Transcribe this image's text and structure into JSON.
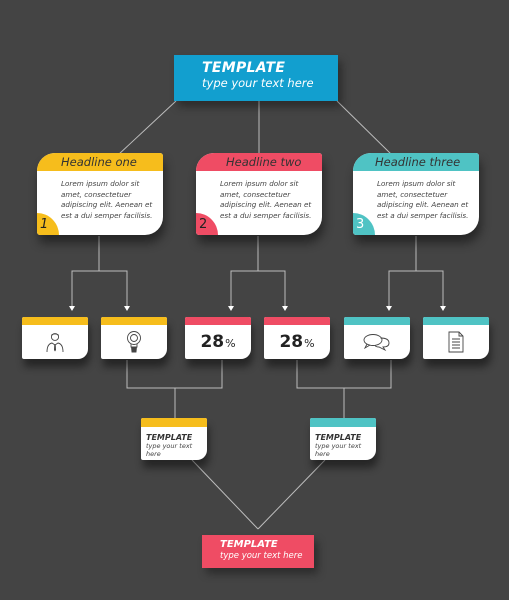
{
  "colors": {
    "background": "#444444",
    "connector": "#bdbdbd",
    "blue": "#129fcf",
    "yellow": "#f6bd1c",
    "red": "#ef4c64",
    "teal": "#4fc3c4"
  },
  "top": {
    "title": "TEMPLATE",
    "subtitle": "type your text here"
  },
  "cards": [
    {
      "headline": "Headline one",
      "number": "1",
      "body": "Lorem ipsum dolor sit amet, consectetuer adipiscing elit. Aenean et est a dui semper facilisis."
    },
    {
      "headline": "Headline two",
      "number": "2",
      "body": "Lorem ipsum dolor sit amet, consectetuer adipiscing elit. Aenean et est a dui semper facilisis."
    },
    {
      "headline": "Headline three",
      "number": "3",
      "body": "Lorem ipsum dolor sit amet, consectetuer adipiscing elit. Aenean et est a dui semper facilisis."
    }
  ],
  "tiles": [
    {
      "type": "icon",
      "icon": "person-icon"
    },
    {
      "type": "icon",
      "icon": "lightbulb-icon"
    },
    {
      "type": "percent",
      "value": "28",
      "unit": "%"
    },
    {
      "type": "percent",
      "value": "28",
      "unit": "%"
    },
    {
      "type": "icon",
      "icon": "chat-bubbles-icon"
    },
    {
      "type": "icon",
      "icon": "document-icon"
    }
  ],
  "mid_boxes": [
    {
      "title": "TEMPLATE",
      "subtitle": "type your text here"
    },
    {
      "title": "TEMPLATE",
      "subtitle": "type your text here"
    }
  ],
  "bottom": {
    "title": "TEMPLATE",
    "subtitle": "type your text here"
  }
}
